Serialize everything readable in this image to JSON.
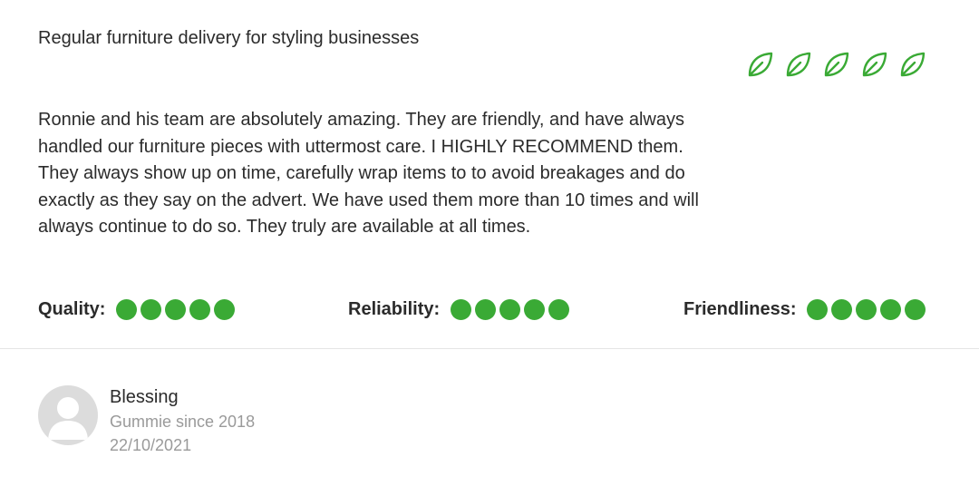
{
  "review": {
    "title": "Regular furniture delivery for styling businesses",
    "leaf_rating": 5,
    "leaf_max": 5,
    "body": "Ronnie and his team are absolutely amazing. They are friendly, and have always handled our furniture pieces with uttermost care. I HIGHLY RECOMMEND them. They always show up on time, carefully wrap items to to avoid breakages and do exactly as they say on the advert. We have used them more than 10 times and will always continue to do so. They truly are available at all times."
  },
  "scores": {
    "quality_label": "Quality:",
    "quality_value": 5,
    "reliability_label": "Reliability:",
    "reliability_value": 5,
    "friendliness_label": "Friendliness:",
    "friendliness_value": 5,
    "max": 5
  },
  "reviewer": {
    "name": "Blessing",
    "member_since": "Gummie since 2018",
    "date": "22/10/2021"
  },
  "colors": {
    "accent_green": "#3aaa35",
    "text": "#2b2b2b",
    "muted": "#9a9a9a",
    "divider": "#e4e4e4",
    "avatar_bg": "#dcdcdc"
  },
  "icons": {
    "leaf": "leaf-icon",
    "avatar": "user-silhouette-icon"
  }
}
